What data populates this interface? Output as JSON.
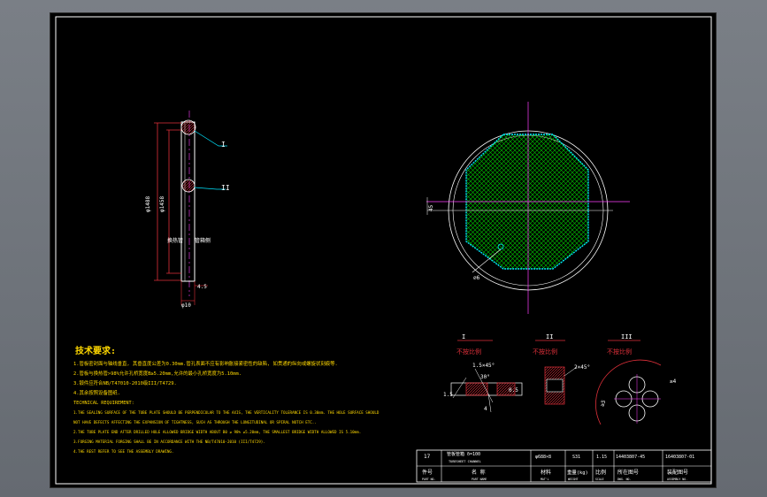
{
  "colors": {
    "frame": "#ffffff",
    "part_red": "#e0303a",
    "leader_cyan": "#00e5ff",
    "center_magenta": "#ff40ff",
    "hatch_green": "#00c800",
    "text_white": "#ffffff",
    "label_yellow": "#ffd800"
  },
  "left_view": {
    "label_I": "I",
    "label_II": "II",
    "dim_outer": "φ1488",
    "dim_inner": "φ1458",
    "dim_bottom": "φ10",
    "dim_thk": "4.5",
    "side_note_1": "换热管",
    "side_note_2": "管箱侧"
  },
  "right_view": {
    "dim_left": "45",
    "note_circle": "∅6"
  },
  "details": {
    "I": {
      "title": "I",
      "scale": "不按比例",
      "chamfer": "1.5×45°",
      "angle": "30°",
      "dim_a": "1.5",
      "dim_b": "0.5",
      "dim_c": "4"
    },
    "II": {
      "title": "II",
      "scale": "不按比例",
      "chamfer": "2×45°"
    },
    "III": {
      "title": "III",
      "scale": "不按比例",
      "dim_a": "≥5",
      "dim_b": "≥4"
    }
  },
  "tech_requirements": {
    "title": "技术要求:",
    "lines": [
      "1.管板密封面与轴线垂直, 其垂直度公差为0.30mm.管孔表面不应有影响胀接紧密性的缺陷, 如贯通的纵向或螺旋状刻痕等.",
      "2.管板与换热管>98%允许孔桥宽度B≥5.20mm,允许的最小孔桥宽度为5.10mm.",
      "3.锻件应符合NB/T47010-2010级III/T4729.",
      "4.其余按照设备图纸.",
      "TECHNICAL REQUIREMENT:",
      "1.THE SEALING SURFACE OF THE TUBE PLATE SHOULD BE PERPENDICULAR TO THE AXIS, THE VERTICALITY TOLERANCE IS 0.30mm. THE HOLE SURFACE SHOULD",
      "NOT HAVE DEFECTS AFFECTING THE EXPANSION OF TIGHTNESS, SUCH AS THROUGH THE LONGITUDINAL OR SPIRAL NOTCH ETC..",
      "2.THE TUBE PLATE END AFTER DRILLED HOLE ALLOWED BRIDGE WIDTH ABOUT B0 ≥ 98% ≥5.20mm, THE SMALLEST BRIDGE WIDTH ALLOWED IS 5.10mm.",
      "3.FORGING MATERIAL FORGING SHALL BE IN ACCORDANCE WITH THE NB/T47010-2010 (III/T4729).",
      "4.THE REST REFER TO SEE THE ASSEMBLY DRAWING."
    ]
  },
  "title_block": {
    "row1": [
      "17",
      "管板管箱  δ=100",
      "φ688×8",
      "S31",
      "1.15",
      "14403807-45",
      "16403807-01"
    ],
    "row1_sub": [
      "",
      "TUBESHEET CHANNEL",
      "",
      "",
      "",
      "",
      ""
    ],
    "row2": [
      "件号",
      "名  称",
      "材料",
      "重量(kg)",
      "比例",
      "所在图号",
      "装配图号"
    ],
    "row2_sub": [
      "PART NO.",
      "PART NAME",
      "MAT'L",
      "WEIGHT",
      "SCALE",
      "DWG. NO.",
      "ASSEMBLY NO."
    ]
  }
}
